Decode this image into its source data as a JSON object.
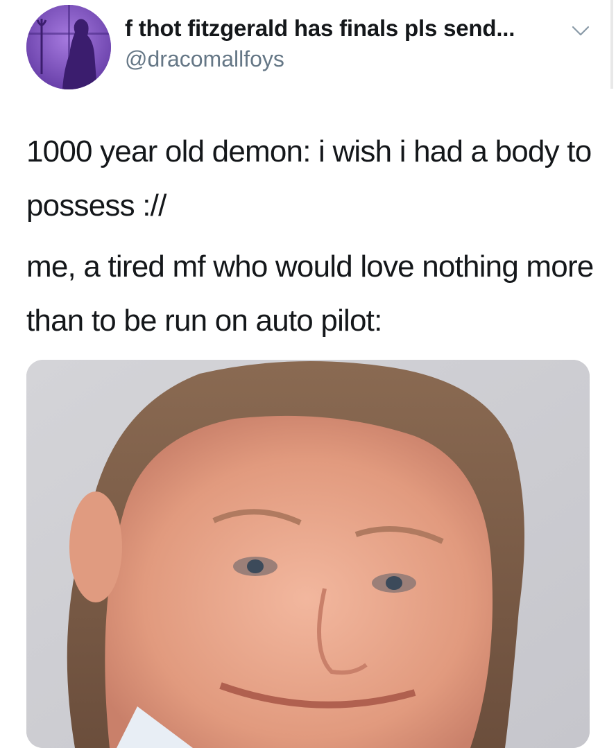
{
  "tweet": {
    "display_name": "f thot fitzgerald has finals pls send...",
    "username": "@dracomallfoys",
    "text_lines": [
      "1000 year old demon: i wish i had a body to possess ://",
      "me, a tired mf who would love nothing more than to be run on auto pilot:"
    ],
    "menu_icon": "chevron-down-icon",
    "avatar_icon": "avatar",
    "media": "photo"
  },
  "colors": {
    "text": "#14171a",
    "secondary": "#657786",
    "avatar_bg": "#7b4fbf"
  }
}
